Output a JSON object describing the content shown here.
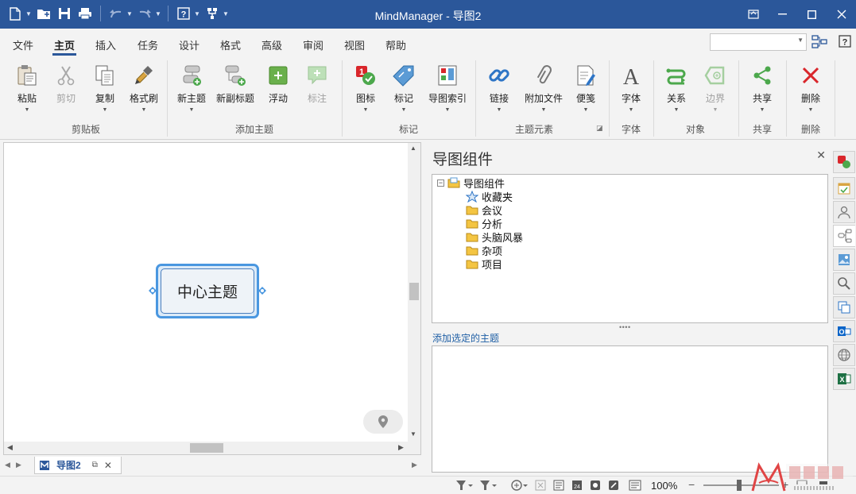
{
  "app": {
    "title": "MindManager - 导图2"
  },
  "ribbon_tabs": [
    "文件",
    "主页",
    "插入",
    "任务",
    "设计",
    "格式",
    "高级",
    "审阅",
    "视图",
    "帮助"
  ],
  "ribbon": {
    "clipboard": {
      "paste": "粘贴",
      "cut": "剪切",
      "copy": "复制",
      "format_painter": "格式刷",
      "group": "剪贴板"
    },
    "add_topic": {
      "new_topic": "新主题",
      "new_subtopic": "新副标题",
      "floating": "浮动",
      "callout": "标注",
      "group": "添加主题"
    },
    "markers": {
      "icons": "图标",
      "tags": "标记",
      "map_index": "导图索引",
      "group": "标记"
    },
    "topic_elements": {
      "link": "链接",
      "attach": "附加文件",
      "notes": "便笺",
      "group": "主题元素"
    },
    "font": {
      "font": "字体",
      "group": "字体"
    },
    "objects": {
      "relation": "关系",
      "boundary": "边界",
      "group": "对象"
    },
    "share": {
      "share": "共享",
      "group": "共享"
    },
    "delete": {
      "delete": "删除",
      "group": "删除"
    }
  },
  "canvas": {
    "central_topic": "中心主题"
  },
  "doc_tab": {
    "name": "导图2"
  },
  "panel": {
    "title": "导图组件",
    "tree_root": "导图组件",
    "tree_items": [
      "收藏夹",
      "会议",
      "分析",
      "头脑风暴",
      "杂项",
      "项目"
    ],
    "add_selected_label": "添加选定的主题"
  },
  "status": {
    "zoom": "100%"
  },
  "colors": {
    "titlebar": "#2b579a",
    "topic_border": "#4a97e0",
    "delete_red": "#d9262b"
  }
}
